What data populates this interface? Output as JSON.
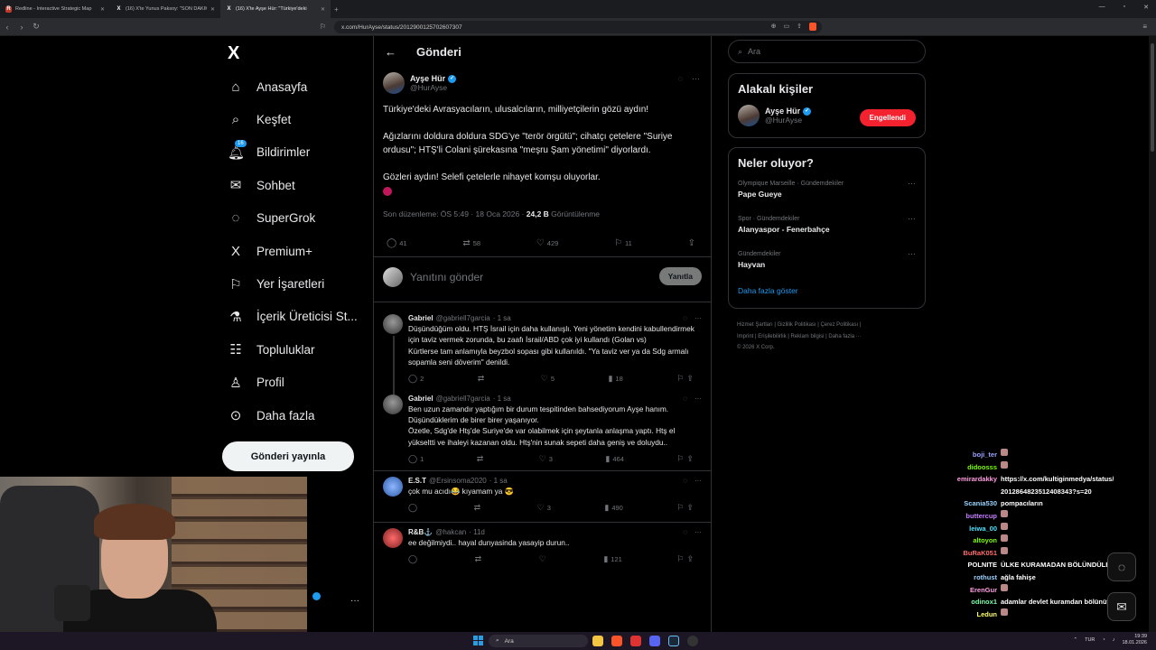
{
  "browser": {
    "tabs": [
      {
        "title": "Redline - Interactive Strategic Map",
        "favicon": "R"
      },
      {
        "title": "(16) X'te Yunus Paksoy: \"SON DAKİKA",
        "favicon": "X"
      },
      {
        "title": "(16) X'te Ayşe Hür: \"Türkiye'deki",
        "favicon": "X"
      }
    ],
    "url": "x.com/HurAyse/status/2012900125702607307"
  },
  "sidebar": {
    "logo": "X",
    "items": [
      {
        "label": "Anasayfa",
        "icon": "⌂",
        "name": "home"
      },
      {
        "label": "Keşfet",
        "icon": "⌕",
        "name": "explore"
      },
      {
        "label": "Bildirimler",
        "icon": "♫",
        "name": "notifications",
        "badge": "16"
      },
      {
        "label": "Sohbet",
        "icon": "✉",
        "name": "chat"
      },
      {
        "label": "SuperGrok",
        "icon": "◌",
        "name": "supergrok"
      },
      {
        "label": "Premium+",
        "icon": "X",
        "name": "premium"
      },
      {
        "label": "Yer İşaretleri",
        "icon": "⚐",
        "name": "bookmarks"
      },
      {
        "label": "İçerik Üreticisi St...",
        "icon": "⚗",
        "name": "creator-studio"
      },
      {
        "label": "Topluluklar",
        "icon": "☷",
        "name": "communities"
      },
      {
        "label": "Profil",
        "icon": "♙",
        "name": "profile"
      },
      {
        "label": "Daha fazla",
        "icon": "⊙",
        "name": "more"
      }
    ],
    "post_button": "Gönderi yayınla"
  },
  "main": {
    "header": "Gönderi",
    "post": {
      "name": "Ayşe Hür",
      "handle": "@HurAyse",
      "text": "Türkiye'deki Avrasyacıların, ulusalcıların, milliyetçilerin gözü aydın!\n\nAğızlarını doldura doldura SDG'ye \"terör örgütü\"; cihatçı çetelere \"Suriye ordusu\"; HTŞ'li Colani şürekasına \"meşru Şam yönetimi\" diyorlardı.\n\nGözleri aydın! Selefi çetelerle nihayet komşu oluyorlar.",
      "meta_prefix": "Son düzenleme: ÖS 5:49 · 18 Oca 2026 · ",
      "views": "24,2 B",
      "views_label": " Görüntülenme",
      "stats": {
        "replies": "41",
        "reposts": "58",
        "likes": "429",
        "bookmarks": "11"
      }
    },
    "reply_placeholder": "Yanıtını gönder",
    "reply_button": "Yanıtla",
    "replies": [
      {
        "name": "Gabriel",
        "handle": "@gabriell7garcia",
        "time": "· 1 sa",
        "text": "Düşündüğüm oldu. HTŞ İsrail için daha kullanışlı. Yeni yönetim kendini kabullendirmek için taviz vermek zorunda, bu zaafı İsrail/ABD çok iyi kullandı (Golan vs)\nKürtlerse tam anlamıyla beyzbol sopası gibi kullanıldı. \"Ya taviz ver ya da Sdg armalı sopamla seni döverim\" denildi.",
        "replies": "2",
        "reposts": "",
        "likes": "5",
        "views": "18"
      },
      {
        "name": "Gabriel",
        "handle": "@gabriell7garcia",
        "time": "· 1 sa",
        "text": "Ben uzun zamandır yaptığım bir durum tespitinden bahsediyorum Ayşe hanım. Düşündüklerim de birer birer yaşanıyor.\nÖzetle, Sdg'de Htş'de Suriye'de var olabilmek için şeytanla anlaşma yaptı. Htş el yükseltti ve ihaleyi kazanan oldu. Htş'nin sunak sepeti daha geniş ve doluydu..",
        "replies": "1",
        "reposts": "",
        "likes": "3",
        "views": "464"
      },
      {
        "name": "E.S.T",
        "handle": "@Ersinsoma2020",
        "time": "· 1 sa",
        "text": "çok mu acıdı😂 kıyamam ya 😎",
        "replies": "",
        "reposts": "",
        "likes": "3",
        "views": "490"
      },
      {
        "name": "R&B⚓",
        "handle": "@hakcan",
        "time": "· 11d",
        "text": "ee değilmiydi.. hayal dunyasinda yasayip durun..",
        "replies": "",
        "reposts": "",
        "likes": "",
        "views": "121"
      }
    ]
  },
  "right": {
    "search_placeholder": "Ara",
    "related_title": "Alakalı kişiler",
    "related": {
      "name": "Ayşe Hür",
      "handle": "@HurAyse",
      "button": "Engellendi"
    },
    "trends_title": "Neler oluyor?",
    "trends": [
      {
        "context": "Olympique Marseille · Gündemdekiler",
        "title": "Pape Gueye"
      },
      {
        "context": "Spor · Gündemdekiler",
        "title": "Alanyaspor - Fenerbahçe"
      },
      {
        "context": "Gündemdekiler",
        "title": "Hayvan"
      }
    ],
    "show_more": "Daha fazla göster",
    "footer_line1": "Hizmet Şartları  |  Gizlilik Politikası  |  Çerez Politikası  |",
    "footer_line2": "Imprint  |  Erişilebilirlik  |  Reklam bilgisi  |  Daha fazla ···",
    "footer_line3": "© 2026 X Corp."
  },
  "stream_chat": [
    {
      "name": "boji_ter",
      "color": "#9aa3ff",
      "msg": ""
    },
    {
      "name": "didoosss",
      "color": "#7cfc00",
      "msg": ""
    },
    {
      "name": "emirardakky",
      "color": "#ff9de2",
      "msg": "https://x.com/kultiginmedya/status/"
    },
    {
      "name": "",
      "color": "#fff",
      "msg": "2012864823512408343?s=20"
    },
    {
      "name": "Scania530",
      "color": "#9ad3ff",
      "msg": "pompacıların"
    },
    {
      "name": "buttercup",
      "color": "#c77dff",
      "msg": ""
    },
    {
      "name": "leiwa_00",
      "color": "#4ee0ff",
      "msg": ""
    },
    {
      "name": "altoyon",
      "color": "#7cfc00",
      "msg": ""
    },
    {
      "name": "BuRaK051",
      "color": "#ff6b6b",
      "msg": ""
    },
    {
      "name": "POLNITE",
      "color": "#ffffff",
      "msg": "ÜLKE KURAMADAN BÖLÜNDÜLER AQ"
    },
    {
      "name": "rothust",
      "color": "#9ad3ff",
      "msg": "ağla fahişe"
    },
    {
      "name": "ErenGur",
      "color": "#ff9de2",
      "msg": ""
    },
    {
      "name": "odinox1",
      "color": "#7cfcaa",
      "msg": "  adamlar devlet kuramdan bölünüyor"
    },
    {
      "name": "Ledun",
      "color": "#ffff66",
      "msg": ""
    }
  ],
  "taskbar": {
    "search": "Ara",
    "lang": "TUR",
    "time": "19:39",
    "date": "18.01.2026"
  }
}
